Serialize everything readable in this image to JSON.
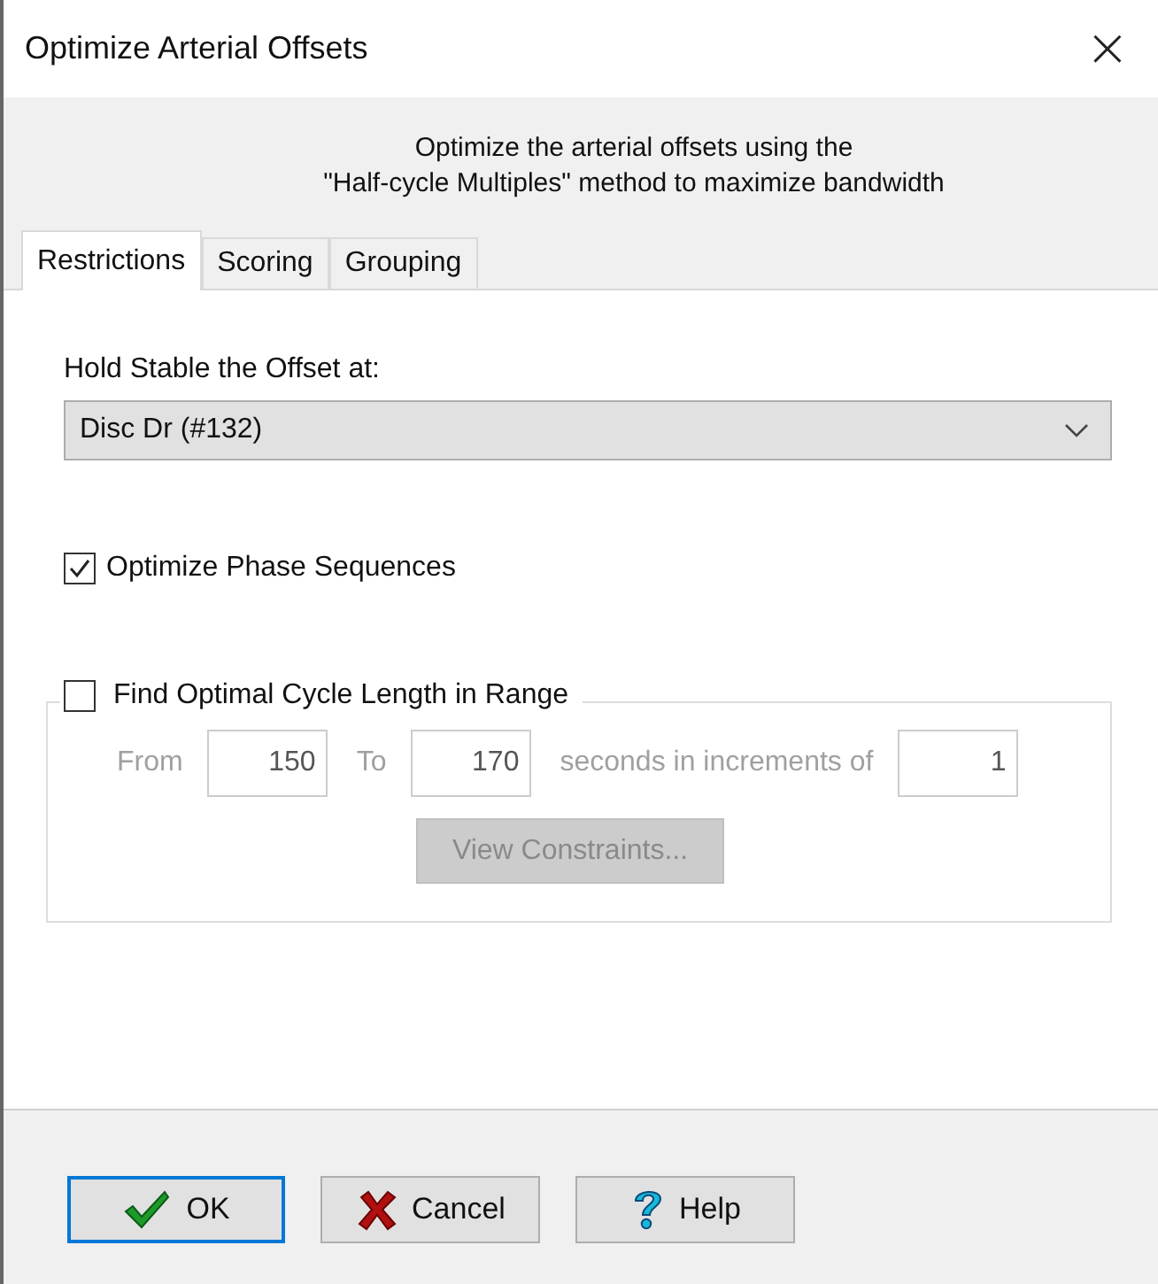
{
  "window": {
    "title": "Optimize Arterial Offsets",
    "close": "×"
  },
  "description": [
    "Optimize the arterial offsets using the",
    "\"Half-cycle Multiples\" method to maximize bandwidth"
  ],
  "tabs": [
    {
      "label": "Restrictions",
      "selected": true
    },
    {
      "label": "Scoring",
      "selected": false
    },
    {
      "label": "Grouping",
      "selected": false
    }
  ],
  "hold_stable": {
    "label": "Hold Stable the Offset at:",
    "value": "Disc Dr (#132)"
  },
  "optimize_phase": {
    "label": "Optimize Phase Sequences",
    "checked": true
  },
  "cycle_range": {
    "label": "Find Optimal Cycle Length in Range",
    "checked": false,
    "disabled": true,
    "from_label": "From",
    "from": "150",
    "to_label": "To",
    "to": "170",
    "increment_label": "seconds in increments of",
    "increment": "1",
    "button": "View Constraints..."
  },
  "buttons": [
    {
      "kind": "ok",
      "label": "OK",
      "focused": true
    },
    {
      "kind": "cancel",
      "label": "Cancel",
      "focused": false
    },
    {
      "kind": "help",
      "label": "Help",
      "focused": false
    }
  ]
}
